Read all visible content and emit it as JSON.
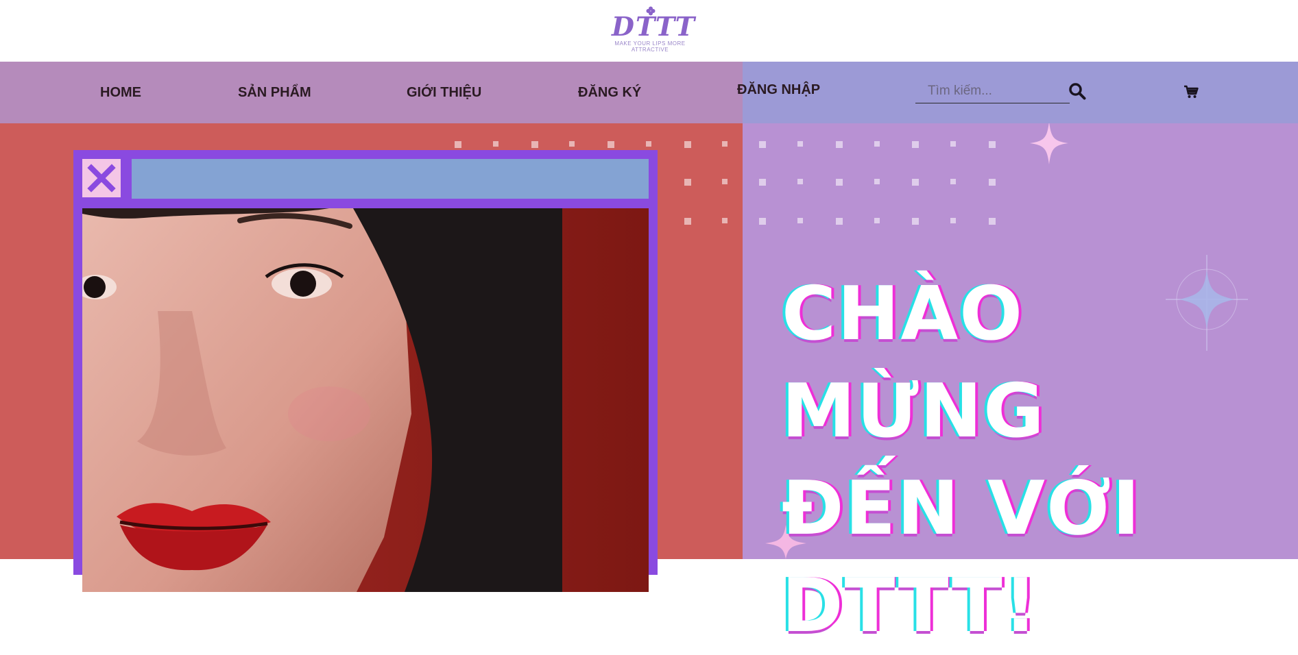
{
  "brand": {
    "logo_text": "DTTT",
    "tagline": "MAKE YOUR LIPS MORE ATTRACTIVE"
  },
  "nav": {
    "items": [
      {
        "label": "HOME"
      },
      {
        "label": "SẢN PHẨM"
      },
      {
        "label": "GIỚI THIỆU"
      },
      {
        "label": "ĐĂNG KÝ"
      },
      {
        "label": "ĐĂNG NHẬP"
      }
    ],
    "search": {
      "placeholder": "Tìm kiếm...",
      "value": ""
    }
  },
  "hero": {
    "headline_line1": "CHÀO MỪNG",
    "headline_line2": "ĐẾN VỚI",
    "headline_line3": "DTTT!"
  },
  "icons": {
    "search": "search-icon",
    "cart": "cart-icon",
    "close": "close-icon"
  },
  "colors": {
    "left_panel": "#cd5c5a",
    "right_panel": "#b891d3",
    "window_frame": "#8a4ae0",
    "title_bar": "#84a3d3",
    "close_button": "#f4c6e6"
  }
}
